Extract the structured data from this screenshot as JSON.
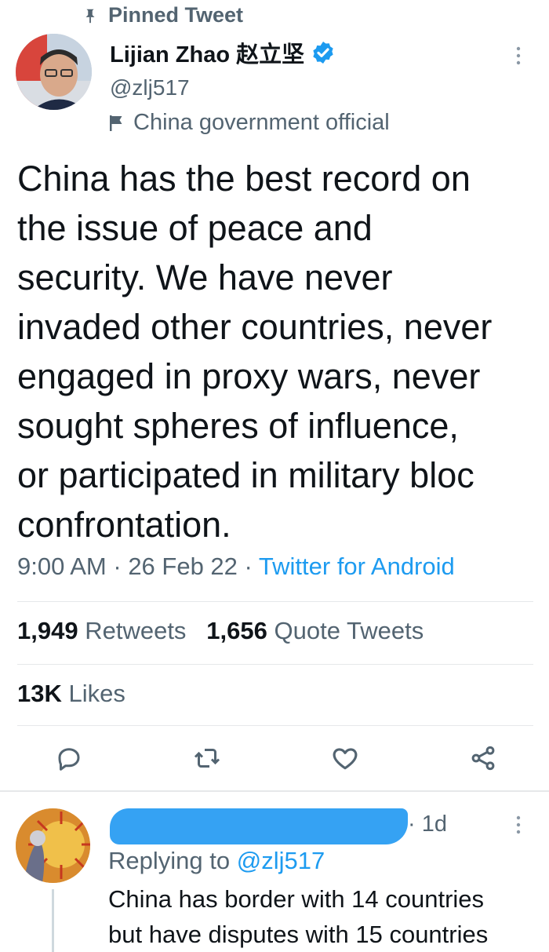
{
  "pinned": {
    "label": "Pinned Tweet"
  },
  "tweet": {
    "author_name": "Lijian Zhao 赵立坚",
    "handle": "@zlj517",
    "account_label": "China government official",
    "text": "China has the best record on\nthe issue of peace and\nsecurity. We have never\ninvaded other countries, never\nengaged in proxy wars, never\nsought spheres of influence,\nor participated in military bloc\nconfrontation.",
    "time": "9:00 AM",
    "date": "26 Feb 22",
    "separator": " · ",
    "source": "Twitter for Android",
    "retweets_count": "1,949",
    "retweets_label": "Retweets",
    "quotes_count": "1,656",
    "quotes_label": "Quote Tweets",
    "likes_count": "13K",
    "likes_label": "Likes"
  },
  "reply": {
    "time": "· 1d",
    "replying_prefix": "Replying to",
    "replying_mention": "@zlj517",
    "text": "China has border with 14 countries\nbut have disputes with 15 countries"
  },
  "colors": {
    "text_primary": "#0f1419",
    "text_secondary": "#536471",
    "accent": "#1d9bf0",
    "divider": "#e6e8ea"
  },
  "icons": {
    "pin": "pin-icon",
    "verified": "verified-badge-icon",
    "flag": "government-flag-icon",
    "more": "more-options-icon",
    "reply": "reply-icon",
    "retweet": "retweet-icon",
    "like": "heart-icon",
    "share": "share-icon"
  }
}
